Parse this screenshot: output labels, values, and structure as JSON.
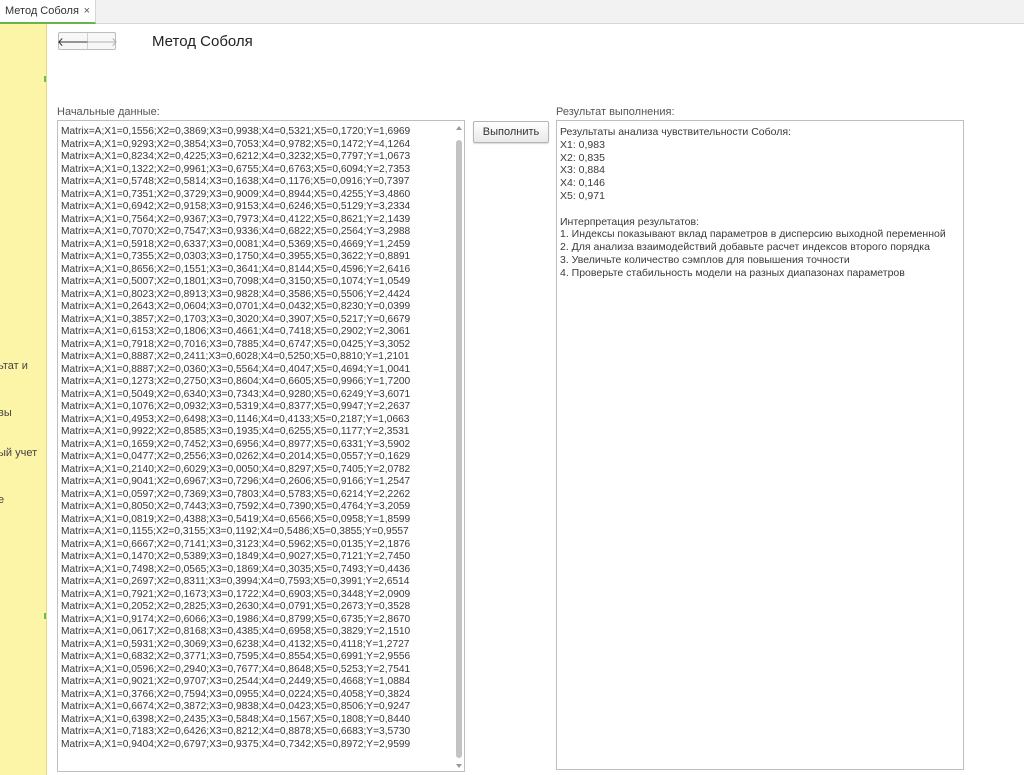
{
  "tab": {
    "label": "Метод Соболя",
    "close": "×"
  },
  "sidebar": {
    "items": [
      "ьтат и",
      "вы",
      "ый учет",
      "е"
    ]
  },
  "nav": {
    "back": "🡐",
    "forward": "🡒"
  },
  "page": {
    "title": "Метод Соболя"
  },
  "input": {
    "label": "Начальные данные:",
    "lines": [
      "Matrix=A;X1=0,1556;X2=0,3869;X3=0,9938;X4=0,5321;X5=0,1720;Y=1,6969",
      "Matrix=A;X1=0,9293;X2=0,3854;X3=0,7053;X4=0,9782;X5=0,1472;Y=4,1264",
      "Matrix=A;X1=0,8234;X2=0,4225;X3=0,6212;X4=0,3232;X5=0,7797;Y=1,0673",
      "Matrix=A;X1=0,1322;X2=0,9961;X3=0,6755;X4=0,6763;X5=0,6094;Y=2,7353",
      "Matrix=A;X1=0,5748;X2=0,5814;X3=0,1638;X4=0,1176;X5=0,0916;Y=0,7397",
      "Matrix=A;X1=0,7351;X2=0,3729;X3=0,9009;X4=0,8944;X5=0,4255;Y=3,4860",
      "Matrix=A;X1=0,6942;X2=0,9158;X3=0,9153;X4=0,6246;X5=0,5129;Y=3,2334",
      "Matrix=A;X1=0,7564;X2=0,9367;X3=0,7973;X4=0,4122;X5=0,8621;Y=2,1439",
      "Matrix=A;X1=0,7070;X2=0,7547;X3=0,9336;X4=0,6822;X5=0,2564;Y=3,2988",
      "Matrix=A;X1=0,5918;X2=0,6337;X3=0,0081;X4=0,5369;X5=0,4669;Y=1,2459",
      "Matrix=A;X1=0,7355;X2=0,0303;X3=0,1750;X4=0,3955;X5=0,3622;Y=0,8891",
      "Matrix=A;X1=0,8656;X2=0,1551;X3=0,3641;X4=0,8144;X5=0,4596;Y=2,6416",
      "Matrix=A;X1=0,5007;X2=0,1801;X3=0,7098;X4=0,3150;X5=0,1074;Y=1,0549",
      "Matrix=A;X1=0,8023;X2=0,8913;X3=0,9828;X4=0,3586;X5=0,5506;Y=2,4424",
      "Matrix=A;X1=0,2643;X2=0,0604;X3=0,0701;X4=0,0432;X5=0,8230;Y=0,0399",
      "Matrix=A;X1=0,3857;X2=0,1703;X3=0,3020;X4=0,3907;X5=0,5217;Y=0,6679",
      "Matrix=A;X1=0,6153;X2=0,1806;X3=0,4661;X4=0,7418;X5=0,2902;Y=2,3061",
      "Matrix=A;X1=0,7918;X2=0,7016;X3=0,7885;X4=0,6747;X5=0,0425;Y=3,3052",
      "Matrix=A;X1=0,8887;X2=0,2411;X3=0,6028;X4=0,5250;X5=0,8810;Y=1,2101",
      "Matrix=A;X1=0,8887;X2=0,0360;X3=0,5564;X4=0,4047;X5=0,4694;Y=1,0041",
      "Matrix=A;X1=0,1273;X2=0,2750;X3=0,8604;X4=0,6605;X5=0,9966;Y=1,7200",
      "Matrix=A;X1=0,5049;X2=0,6340;X3=0,7343;X4=0,9280;X5=0,6249;Y=3,6071",
      "Matrix=A;X1=0,1076;X2=0,0932;X3=0,5319;X4=0,8377;X5=0,9947;Y=2,2637",
      "Matrix=A;X1=0,4953;X2=0,6498;X3=0,1146;X4=0,4133;X5=0,2187;Y=1,0663",
      "Matrix=A;X1=0,9922;X2=0,8585;X3=0,1935;X4=0,6255;X5=0,1177;Y=2,3531",
      "Matrix=A;X1=0,1659;X2=0,7452;X3=0,6956;X4=0,8977;X5=0,6331;Y=3,5902",
      "Matrix=A;X1=0,0477;X2=0,2556;X3=0,0262;X4=0,2014;X5=0,0557;Y=0,1629",
      "Matrix=A;X1=0,2140;X2=0,6029;X3=0,0050;X4=0,8297;X5=0,7405;Y=2,0782",
      "Matrix=A;X1=0,9041;X2=0,6967;X3=0,7296;X4=0,2606;X5=0,9166;Y=1,2547",
      "Matrix=A;X1=0,0597;X2=0,7369;X3=0,7803;X4=0,5783;X5=0,6214;Y=2,2262",
      "Matrix=A;X1=0,8050;X2=0,7443;X3=0,7592;X4=0,7390;X5=0,4764;Y=3,2059",
      "Matrix=A;X1=0,0819;X2=0,4388;X3=0,5419;X4=0,6566;X5=0,0958;Y=1,8599",
      "Matrix=A;X1=0,1155;X2=0,3155;X3=0,1192;X4=0,5486;X5=0,3855;Y=0,9557",
      "Matrix=A;X1=0,6667;X2=0,7141;X3=0,3123;X4=0,5962;X5=0,0135;Y=2,1876",
      "Matrix=A;X1=0,1470;X2=0,5389;X3=0,1849;X4=0,9027;X5=0,7121;Y=2,7450",
      "Matrix=A;X1=0,7498;X2=0,0565;X3=0,1869;X4=0,3035;X5=0,7493;Y=0,4436",
      "Matrix=A;X1=0,2697;X2=0,8311;X3=0,3994;X4=0,7593;X5=0,3991;Y=2,6514",
      "Matrix=A;X1=0,7921;X2=0,1673;X3=0,1722;X4=0,6903;X5=0,3448;Y=2,0909",
      "Matrix=A;X1=0,2052;X2=0,2825;X3=0,2630;X4=0,0791;X5=0,2673;Y=0,3528",
      "Matrix=A;X1=0,9174;X2=0,6066;X3=0,1986;X4=0,8799;X5=0,6735;Y=2,8670",
      "Matrix=A;X1=0,0617;X2=0,8168;X3=0,4385;X4=0,6958;X5=0,3829;Y=2,1510",
      "Matrix=A;X1=0,5931;X2=0,3069;X3=0,6238;X4=0,4132;X5=0,4118;Y=1,2727",
      "Matrix=A;X1=0,6832;X2=0,3771;X3=0,7595;X4=0,8554;X5=0,6991;Y=2,9556",
      "Matrix=A;X1=0,0596;X2=0,2940;X3=0,7677;X4=0,8648;X5=0,5253;Y=2,7541",
      "Matrix=A;X1=0,9021;X2=0,9707;X3=0,2544;X4=0,2449;X5=0,4668;Y=1,0884",
      "Matrix=A;X1=0,3766;X2=0,7594;X3=0,0955;X4=0,0224;X5=0,4058;Y=0,3824",
      "Matrix=A;X1=0,6674;X2=0,3872;X3=0,9838;X4=0,0423;X5=0,8506;Y=0,9247",
      "Matrix=A;X1=0,6398;X2=0,2435;X3=0,5848;X4=0,1567;X5=0,1808;Y=0,8440",
      "Matrix=A;X1=0,7183;X2=0,6426;X3=0,8212;X4=0,8878;X5=0,6683;Y=3,5730",
      "Matrix=A;X1=0,9404;X2=0,6797;X3=0,9375;X4=0,7342;X5=0,8972;Y=2,9599"
    ]
  },
  "run_button": {
    "label": "Выполнить"
  },
  "result": {
    "label": "Результат выполнения:",
    "lines": [
      "Результаты анализа чувствительности Соболя:",
      "X1: 0,983",
      "X2: 0,835",
      "X3: 0,884",
      "X4: 0,146",
      "X5: 0,971",
      "",
      "Интерпретация результатов:",
      "1. Индексы показывают вклад параметров в дисперсию выходной переменной",
      "2. Для анализа взаимодействий добавьте расчет индексов второго порядка",
      "3. Увеличьте количество сэмплов для повышения точности",
      "4. Проверьте стабильность модели на разных диапазонах параметров"
    ]
  }
}
